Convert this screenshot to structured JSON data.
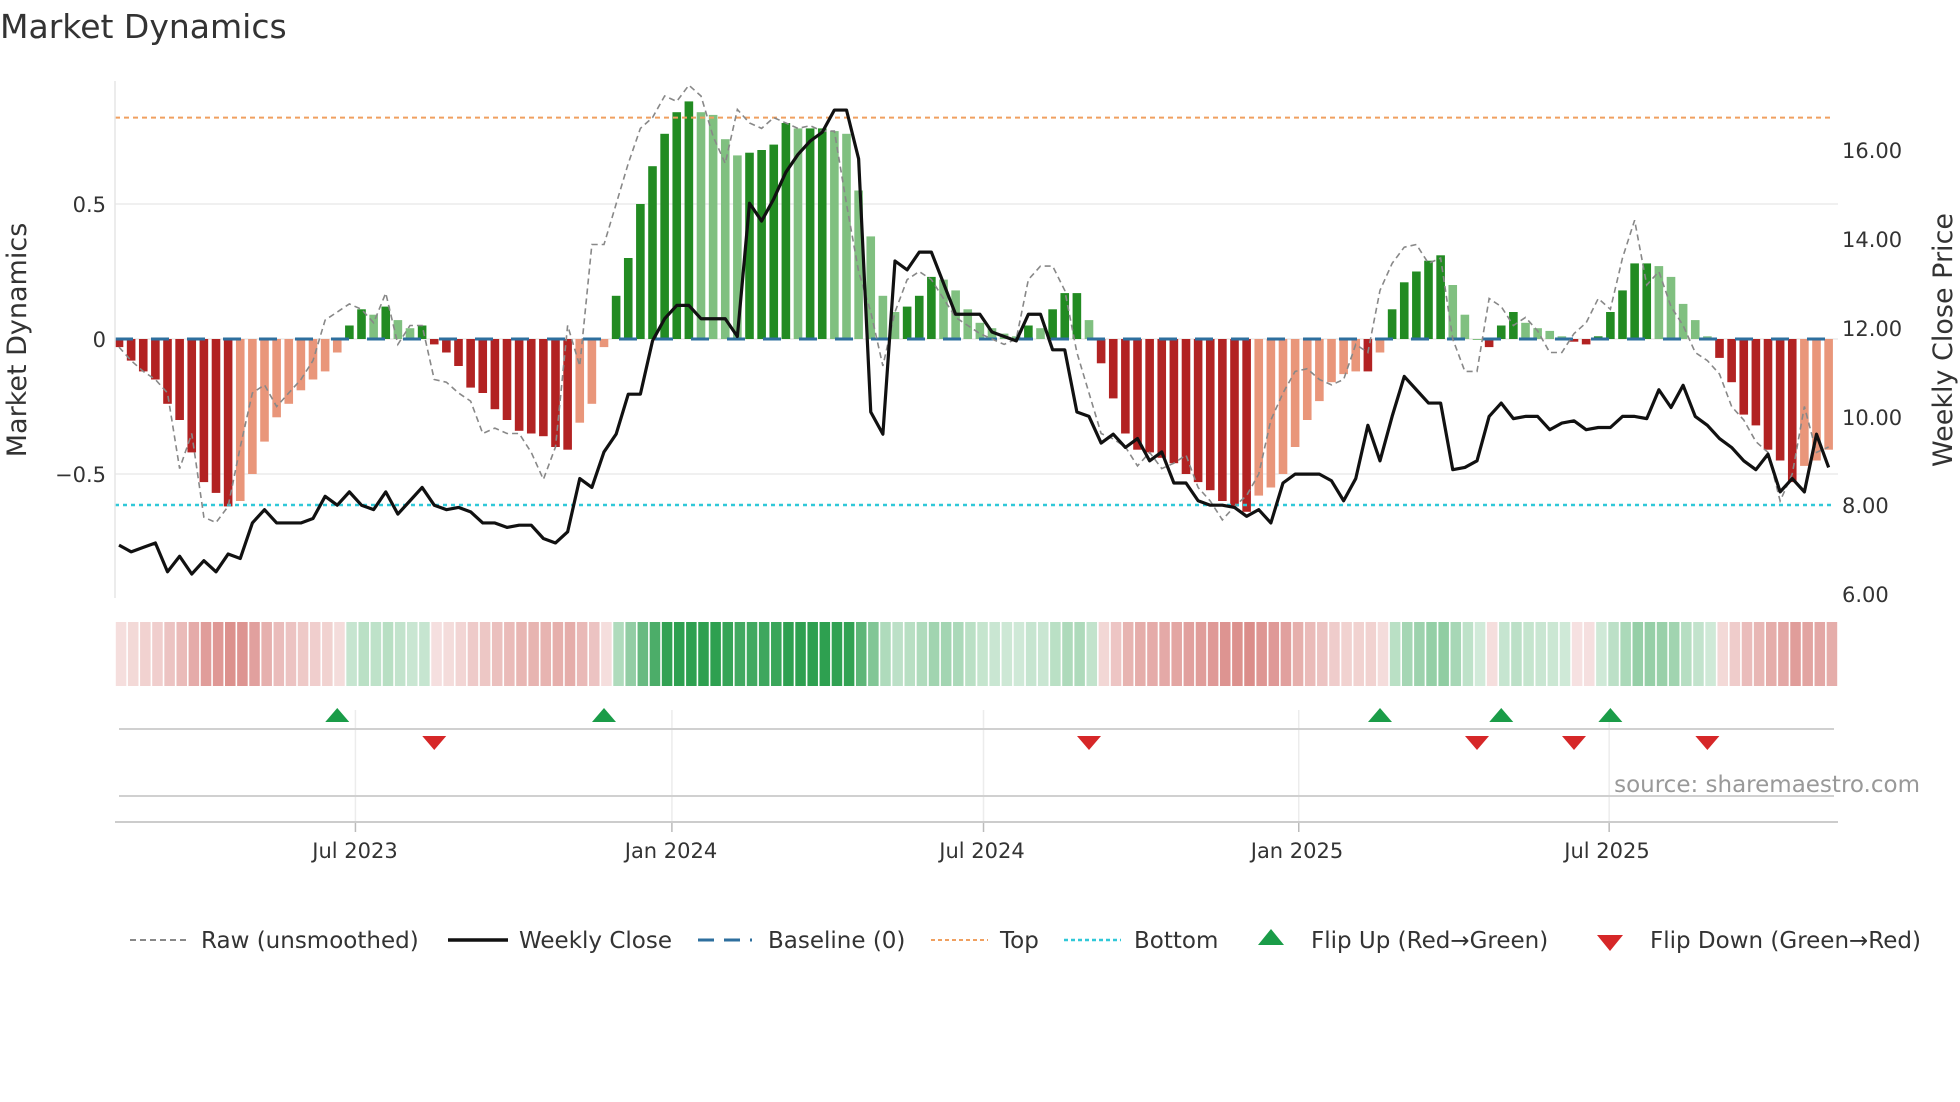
{
  "chart_data": {
    "type": "bar",
    "title": "Market Dynamics",
    "ylabel_left": "Market Dynamics",
    "ylabel_right": "Weekly Close Price",
    "source": "source: sharemaestro.com",
    "frequency": "weekly",
    "x_start": "2023-02-14",
    "ylim_left": [
      -0.93,
      0.97
    ],
    "ylim_right": [
      6.0,
      17.6
    ],
    "yticks_left": [
      "0.5",
      "0",
      "−0.5"
    ],
    "yticks_left_values": [
      0.5,
      0,
      -0.5
    ],
    "yticks_right": [
      "16.00",
      "14.00",
      "12.00",
      "10.00",
      "8.00",
      "6.00"
    ],
    "yticks_right_values": [
      16,
      14,
      12,
      10,
      8,
      6
    ],
    "xticks": [
      "Jul 2023",
      "Jan 2024",
      "Jul 2024",
      "Jan 2025",
      "Jul 2025"
    ],
    "xticks_week_index": [
      19.5,
      45.6,
      71.3,
      97.3,
      122.9
    ],
    "top_level": 0.82,
    "bottom_level": -0.615,
    "baseline": 0,
    "colors": {
      "strong_up": "#228b22",
      "weak_up": "#80c080",
      "strong_down": "#b22222",
      "weak_down": "#e9967a",
      "close": "#111111",
      "raw": "#888888",
      "baseline": "#2e6f9e",
      "top": "#f0a060",
      "bottom": "#30c8d8",
      "flip_up": "#1a9c48",
      "flip_down": "#d62728"
    },
    "momentum": [
      -0.03,
      -0.08,
      -0.12,
      -0.15,
      -0.24,
      -0.3,
      -0.42,
      -0.53,
      -0.57,
      -0.62,
      -0.6,
      -0.5,
      -0.38,
      -0.29,
      -0.24,
      -0.19,
      -0.15,
      -0.12,
      -0.05,
      0.05,
      0.11,
      0.09,
      0.12,
      0.07,
      0.04,
      0.05,
      -0.02,
      -0.05,
      -0.1,
      -0.18,
      -0.2,
      -0.26,
      -0.3,
      -0.34,
      -0.35,
      -0.36,
      -0.4,
      -0.41,
      -0.31,
      -0.24,
      -0.03,
      0.16,
      0.3,
      0.5,
      0.64,
      0.76,
      0.84,
      0.88,
      0.84,
      0.83,
      0.74,
      0.68,
      0.69,
      0.7,
      0.72,
      0.8,
      0.78,
      0.78,
      0.78,
      0.77,
      0.76,
      0.55,
      0.38,
      0.16,
      0.1,
      0.12,
      0.16,
      0.23,
      0.22,
      0.18,
      0.11,
      0.06,
      0.04,
      0.02,
      0.01,
      0.05,
      0.04,
      0.11,
      0.17,
      0.17,
      0.07,
      -0.09,
      -0.22,
      -0.35,
      -0.41,
      -0.42,
      -0.44,
      -0.46,
      -0.5,
      -0.53,
      -0.56,
      -0.6,
      -0.62,
      -0.64,
      -0.58,
      -0.55,
      -0.5,
      -0.4,
      -0.3,
      -0.23,
      -0.16,
      -0.13,
      -0.12,
      -0.12,
      -0.05,
      0.11,
      0.21,
      0.25,
      0.29,
      0.31,
      0.2,
      0.09,
      0.0,
      -0.03,
      0.05,
      0.1,
      0.06,
      0.04,
      0.03,
      0.01,
      -0.01,
      -0.02,
      0.01,
      0.1,
      0.18,
      0.28,
      0.28,
      0.27,
      0.23,
      0.13,
      0.07,
      0.01,
      -0.07,
      -0.16,
      -0.28,
      -0.32,
      -0.41,
      -0.45,
      -0.53,
      -0.47,
      -0.45,
      -0.41
    ],
    "raw": [
      -0.03,
      -0.08,
      -0.12,
      -0.15,
      -0.2,
      -0.48,
      -0.35,
      -0.66,
      -0.68,
      -0.62,
      -0.4,
      -0.2,
      -0.17,
      -0.25,
      -0.2,
      -0.15,
      -0.08,
      0.07,
      0.1,
      0.13,
      0.11,
      0.06,
      0.17,
      -0.02,
      0.05,
      0.05,
      -0.15,
      -0.16,
      -0.2,
      -0.23,
      -0.35,
      -0.33,
      -0.35,
      -0.35,
      -0.42,
      -0.52,
      -0.4,
      0.05,
      -0.1,
      0.35,
      0.35,
      0.5,
      0.65,
      0.78,
      0.82,
      0.9,
      0.88,
      0.94,
      0.9,
      0.75,
      0.65,
      0.85,
      0.8,
      0.78,
      0.82,
      0.8,
      0.78,
      0.79,
      0.77,
      0.77,
      0.5,
      0.25,
      0.1,
      -0.1,
      0.1,
      0.22,
      0.25,
      0.22,
      0.15,
      0.08,
      0.05,
      0.02,
      0.0,
      -0.02,
      0.0,
      0.22,
      0.27,
      0.27,
      0.18,
      -0.05,
      -0.2,
      -0.35,
      -0.37,
      -0.4,
      -0.47,
      -0.42,
      -0.48,
      -0.46,
      -0.43,
      -0.55,
      -0.6,
      -0.67,
      -0.62,
      -0.58,
      -0.5,
      -0.3,
      -0.2,
      -0.12,
      -0.11,
      -0.15,
      -0.17,
      -0.15,
      -0.02,
      -0.05,
      0.18,
      0.28,
      0.34,
      0.35,
      0.28,
      0.3,
      0.0,
      -0.12,
      -0.12,
      0.15,
      0.12,
      0.05,
      0.08,
      0.03,
      -0.05,
      -0.05,
      0.02,
      0.06,
      0.15,
      0.11,
      0.3,
      0.44,
      0.2,
      0.25,
      0.12,
      0.05,
      -0.05,
      -0.08,
      -0.13,
      -0.25,
      -0.3,
      -0.38,
      -0.42,
      -0.6,
      -0.5,
      -0.25,
      -0.42,
      -0.4
    ],
    "close": [
      7.1,
      6.95,
      7.05,
      7.15,
      6.5,
      6.85,
      6.45,
      6.75,
      6.5,
      6.9,
      6.8,
      7.6,
      7.9,
      7.6,
      7.6,
      7.6,
      7.7,
      8.2,
      8.0,
      8.3,
      8.0,
      7.9,
      8.3,
      7.8,
      8.1,
      8.4,
      8.0,
      7.9,
      7.95,
      7.85,
      7.6,
      7.6,
      7.5,
      7.55,
      7.55,
      7.25,
      7.15,
      7.4,
      8.6,
      8.4,
      9.2,
      9.6,
      10.5,
      10.5,
      11.7,
      12.2,
      12.5,
      12.5,
      12.2,
      12.2,
      12.2,
      11.8,
      14.8,
      14.4,
      14.9,
      15.5,
      15.9,
      16.2,
      16.4,
      16.9,
      16.9,
      15.8,
      10.1,
      9.6,
      13.5,
      13.3,
      13.7,
      13.7,
      13.0,
      12.3,
      12.3,
      12.3,
      11.9,
      11.8,
      11.7,
      12.3,
      12.3,
      11.5,
      11.5,
      10.1,
      10.0,
      9.4,
      9.6,
      9.3,
      9.5,
      9.0,
      9.2,
      8.5,
      8.5,
      8.1,
      8.0,
      8.0,
      7.95,
      7.75,
      7.9,
      7.6,
      8.5,
      8.7,
      8.7,
      8.7,
      8.55,
      8.1,
      8.6,
      9.8,
      9.0,
      10.0,
      10.9,
      10.6,
      10.3,
      10.3,
      8.8,
      8.85,
      9.0,
      10.0,
      10.3,
      9.95,
      10.0,
      10.0,
      9.7,
      9.85,
      9.9,
      9.7,
      9.75,
      9.75,
      10.0,
      10.0,
      9.95,
      10.6,
      10.2,
      10.7,
      10.0,
      9.8,
      9.5,
      9.3,
      9.0,
      8.8,
      9.15,
      8.3,
      8.6,
      8.3,
      9.6,
      8.85
    ],
    "flips_up_week_index": [
      18,
      40,
      104,
      114,
      123
    ],
    "flips_down_week_index": [
      26,
      80,
      112,
      120,
      131
    ],
    "legend": {
      "raw": "Raw (unsmoothed)",
      "close": "Weekly Close",
      "baseline": "Baseline (0)",
      "top": "Top",
      "bottom": "Bottom",
      "flip_up": "Flip Up (Red→Green)",
      "flip_down": "Flip Down (Green→Red)"
    },
    "legend_position": "bottom"
  }
}
